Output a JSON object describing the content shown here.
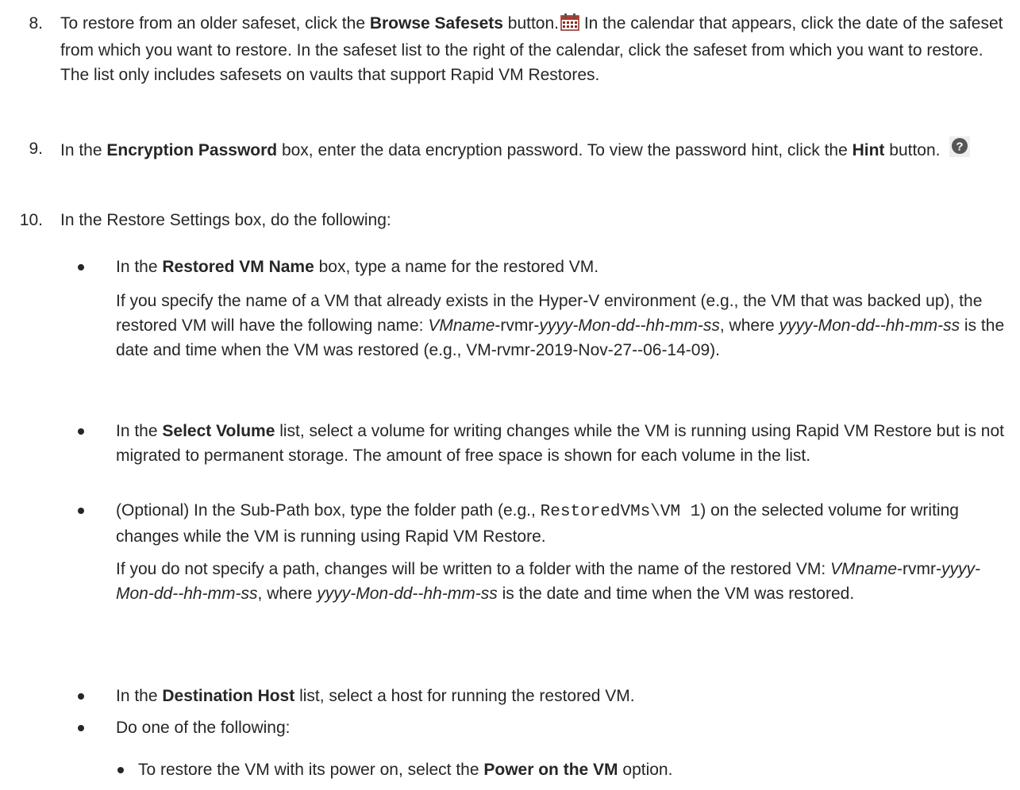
{
  "step8": {
    "num": "8.",
    "t1": "To restore from an older safeset, click the ",
    "b1": "Browse Safesets",
    "t2": " button.",
    "icon": "calendar-icon",
    "t3": " In the calendar that appears, click the date of the safeset from which you want to restore. In the safeset list to the right of the calendar, click the safeset from which you want to restore. The list only includes safesets on vaults that support Rapid VM Restores."
  },
  "step9": {
    "num": "9.",
    "t1": "In the ",
    "b1": "Encryption Password",
    "t2": " box, enter the data encryption password. To view the password hint, click the ",
    "b2": "Hint",
    "t3": " button.",
    "icon": "help-icon"
  },
  "step10": {
    "num": "10.",
    "intro": "In the Restore Settings box, do the following:",
    "bullet1": {
      "t1": "In the ",
      "b1": "Restored VM Name",
      "t2": " box, type a name for the restored VM.",
      "p2_t1": "If you specify the name of a VM that already exists in the Hyper-V environment (e.g., the VM that was backed up), the restored VM will have the following name: ",
      "p2_i1": "VMname",
      "p2_t2": "-rvmr-",
      "p2_i2": "yyyy-Mon-dd--hh-mm-ss",
      "p2_t3": ", where ",
      "p2_i3": "yyyy-Mon-dd--hh-mm-ss",
      "p2_t4": " is the date and time when the VM was restored (e.g., VM-rvmr-2019-Nov-27--06-14-09)."
    },
    "bullet2": {
      "t1": "In the ",
      "b1": "Select Volume",
      "t2": " list, select a volume for writing changes while the VM is running using Rapid VM Restore but is not migrated to permanent storage. The amount of free space is shown for each volume in the list."
    },
    "bullet3": {
      "t1": "(Optional) In the Sub-Path box, type the folder path (e.g., ",
      "code": "RestoredVMs\\VM 1",
      "t2": ") on the selected volume for writing changes while the VM is running using Rapid VM Restore.",
      "p2_t1": "If you do not specify a path, changes will be written to a folder with the name of the restored VM: ",
      "p2_i1": "VMname",
      "p2_t2": "-rvmr-",
      "p2_i2": "yyyy-Mon-dd--hh-mm-ss",
      "p2_t3": ", where ",
      "p2_i3": "yyyy-Mon-dd--hh-mm-ss",
      "p2_t4": " is the date and time when the VM was restored."
    },
    "bullet4": {
      "t1": "In the ",
      "b1": "Destination Host",
      "t2": " list, select a host for running the restored VM."
    },
    "bullet5": {
      "t1": "Do one of the following:"
    },
    "sub1": {
      "t1": "To restore the VM with its power on, select the ",
      "b1": "Power on the VM",
      "t2": " option."
    }
  },
  "colors": {
    "text": "#262626",
    "calendar_icon": "#b03a2e",
    "help_icon_bg": "#555555"
  }
}
